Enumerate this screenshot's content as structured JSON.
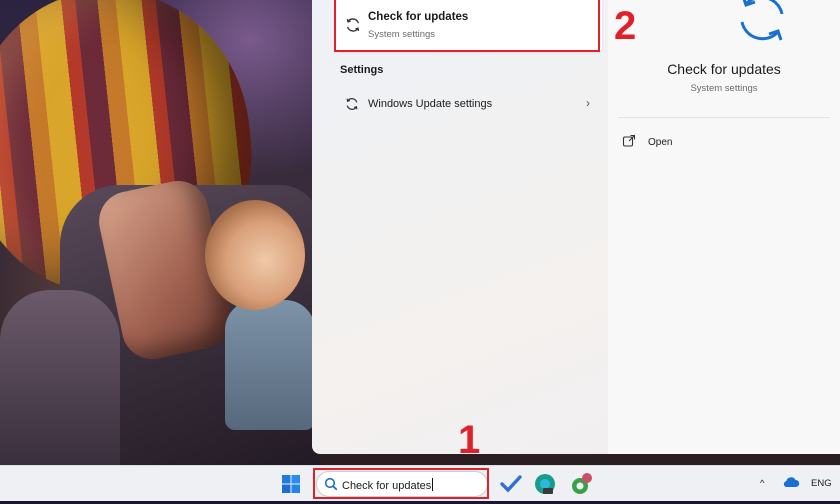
{
  "panel": {
    "best_match": {
      "title": "Check for updates",
      "subtitle": "System settings",
      "icon": "sync-icon"
    },
    "section_heading": "Settings",
    "results": [
      {
        "label": "Windows Update settings",
        "icon": "sync-icon",
        "chevron": "›"
      }
    ],
    "detail": {
      "title": "Check for updates",
      "subtitle": "System settings",
      "actions": [
        {
          "label": "Open",
          "icon": "open-external-icon"
        }
      ]
    }
  },
  "annotations": {
    "step1": "1",
    "step2": "2",
    "highlight_color": "#e0202a"
  },
  "taskbar": {
    "search": {
      "value": "Check for updates",
      "icon": "search-icon"
    },
    "tray": {
      "chevron": "^",
      "language": "ENG"
    },
    "apps": [
      "windows-start-icon",
      "todo-check-icon",
      "edge-dev-icon",
      "green-app-icon"
    ]
  }
}
